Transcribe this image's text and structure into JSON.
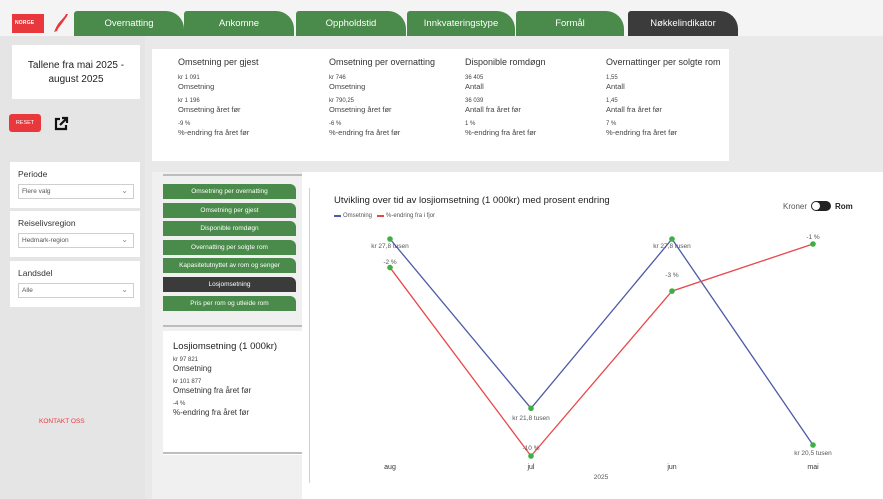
{
  "brand": {
    "logo_text": "NORGE"
  },
  "tabs": [
    {
      "label": "Overnatting",
      "active": false
    },
    {
      "label": "Ankomne",
      "active": false
    },
    {
      "label": "Oppholdstid",
      "active": false
    },
    {
      "label": "Innkvateringstype",
      "active": false
    },
    {
      "label": "Formål",
      "active": false
    },
    {
      "label": "Nøkkelindikator",
      "active": true
    }
  ],
  "sidebar": {
    "period_text_1": "Tallene fra mai 2025 -",
    "period_text_2": "august 2025",
    "reset_label": "RESET",
    "contact_label": "KONTAKT OSS",
    "slicers": [
      {
        "label": "Periode",
        "value": "Flere valg"
      },
      {
        "label": "Reiselivsregion",
        "value": "Hedmark-region"
      },
      {
        "label": "Landsdel",
        "value": "Alle"
      }
    ]
  },
  "kpis": [
    {
      "title": "Omsetning per gjest",
      "value": "kr 1 091",
      "value_label": "Omsetning",
      "prev": "kr 1 196",
      "prev_label": "Omsetning året før",
      "change": "-9 %",
      "change_label": "%-endring fra året før"
    },
    {
      "title": "Omsetning per overnatting",
      "value": "kr 746",
      "value_label": "Omsetning",
      "prev": "kr 790,25",
      "prev_label": "Omsetning året før",
      "change": "-6 %",
      "change_label": "%-endring fra året før"
    },
    {
      "title": "Disponible romdøgn",
      "value": "36 405",
      "value_label": "Antall",
      "prev": "36 039",
      "prev_label": "Antall fra året før",
      "change": "1 %",
      "change_label": "%-endring fra året før"
    },
    {
      "title": "Overnattinger per solgte rom",
      "value": "1,55",
      "value_label": "Antall",
      "prev": "1,45",
      "prev_label": "Antall fra året før",
      "change": "7 %",
      "change_label": "%-endring fra året før"
    }
  ],
  "menu": [
    {
      "label": "Omsetning per overnatting",
      "active": false
    },
    {
      "label": "Omsetning per gjest",
      "active": false
    },
    {
      "label": "Disponible romdøgn",
      "active": false
    },
    {
      "label": "Overnatting per solgte rom",
      "active": false
    },
    {
      "label": "Kapasitetutnyttet av rom og senger",
      "active": false
    },
    {
      "label": "Losjomsetning",
      "active": true
    },
    {
      "label": "Pris per rom og utleide rom",
      "active": false
    }
  ],
  "losji": {
    "title": "Losjiomsetning (1 000kr)",
    "value": "kr 97 821",
    "value_label": "Omsetning",
    "prev": "kr 101 877",
    "prev_label": "Omsetning fra året før",
    "change": "-4 %",
    "change_label": "%-endring fra året før"
  },
  "toggle": {
    "left": "Kroner",
    "right": "Rom"
  },
  "colors": {
    "green": "#4a8a4a",
    "dark": "#3b3b3b",
    "red": "#e8383b",
    "blue_line": "#4e5aa8",
    "red_line": "#e8484b",
    "marker": "#3cb043"
  },
  "chart_data": {
    "type": "line",
    "title": "Utvikling over tid av losjiomsetning (1 000kr) med prosent endring",
    "categories": [
      "aug",
      "jul",
      "jun",
      "mai"
    ],
    "xlabel": "2025",
    "legend": "top-left",
    "series": [
      {
        "name": "Omsetning",
        "values": [
          27.8,
          21.8,
          27.8,
          20.5
        ],
        "labels": [
          "kr 27,8 tusen",
          "kr 21,8 tusen",
          "kr 27,8 tusen",
          "kr 20,5 tusen"
        ],
        "color": "#4e5aa8"
      },
      {
        "name": "%-endring fra i fjor",
        "values": [
          -2,
          -10,
          -3,
          -1
        ],
        "labels": [
          "-2 %",
          "-10 %",
          "-3 %",
          "-1 %"
        ],
        "color": "#e8484b"
      }
    ]
  }
}
